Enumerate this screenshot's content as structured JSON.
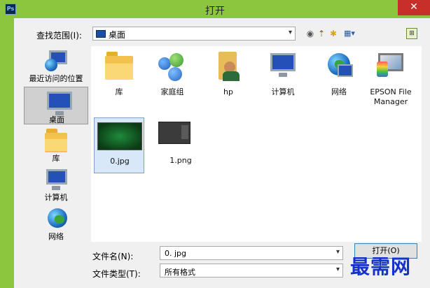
{
  "window": {
    "app_icon_text": "Ps",
    "title": "打开",
    "close_symbol": "✕"
  },
  "lookin": {
    "label": "查找范围(I):",
    "value": "桌面"
  },
  "toolbar": {
    "back_symbol": "◉",
    "up_symbol": "⇡",
    "new_folder_symbol": "✱",
    "view_symbol": "▦▾",
    "extra_symbol": "⊞"
  },
  "places": [
    {
      "label": "最近访问的位置",
      "icon": "recent-places-icon"
    },
    {
      "label": "桌面",
      "icon": "desktop-icon",
      "selected": true
    },
    {
      "label": "库",
      "icon": "library-icon"
    },
    {
      "label": "计算机",
      "icon": "computer-icon"
    },
    {
      "label": "网络",
      "icon": "network-icon"
    }
  ],
  "files": [
    {
      "label": "库",
      "icon": "library-icon"
    },
    {
      "label": "家庭组",
      "icon": "homegroup-icon"
    },
    {
      "label": "hp",
      "icon": "user-folder-icon"
    },
    {
      "label": "计算机",
      "icon": "computer-icon"
    },
    {
      "label": "网络",
      "icon": "network-icon"
    },
    {
      "label": "EPSON File Manager",
      "icon": "epson-icon"
    },
    {
      "label": "0.jpg",
      "icon": "image-thumbnail-icon",
      "selected": true
    },
    {
      "label": "1.png",
      "icon": "image-thumbnail-icon"
    }
  ],
  "filename": {
    "label": "文件名(N):",
    "value": "0. jpg"
  },
  "filetype": {
    "label": "文件类型(T):",
    "value": "所有格式"
  },
  "buttons": {
    "open": "打开(O)"
  },
  "watermark": "最需网",
  "colors": {
    "accent_green": "#8cc63f",
    "close_red": "#c7302a",
    "selection_blue": "#d8e8f8",
    "watermark_blue": "#1532c8"
  }
}
